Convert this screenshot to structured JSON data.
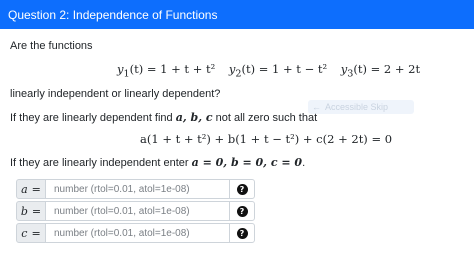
{
  "header": {
    "title": "Question 2: Independence of Functions"
  },
  "question": {
    "intro": "Are the functions",
    "functions": [
      {
        "name": "y",
        "sub": "1",
        "expr": "(t) = 1 + t + t²"
      },
      {
        "name": "y",
        "sub": "2",
        "expr": "(t) = 1 + t − t²"
      },
      {
        "name": "y",
        "sub": "3",
        "expr": "(t) = 2 + 2t"
      }
    ],
    "prompt2": "linearly independent or linearly dependent?",
    "dependent_prefix": "If they are linearly dependent find ",
    "dependent_vars": "a, b, c",
    "dependent_suffix": " not all zero such that",
    "combination": "a(1 + t + t²) + b(1 + t − t²) + c(2 + 2t) = 0",
    "independent_prefix": "If they are linearly independent enter ",
    "independent_math": "a = 0, b = 0, c = 0",
    "independent_suffix": "."
  },
  "nav_tip": {
    "label": "Accessible Skip"
  },
  "answers": [
    {
      "var": "a",
      "eq": "=",
      "placeholder": "number (rtol=0.01, atol=1e-08)"
    },
    {
      "var": "b",
      "eq": "=",
      "placeholder": "number (rtol=0.01, atol=1e-08)"
    },
    {
      "var": "c",
      "eq": "=",
      "placeholder": "number (rtol=0.01, atol=1e-08)"
    }
  ]
}
